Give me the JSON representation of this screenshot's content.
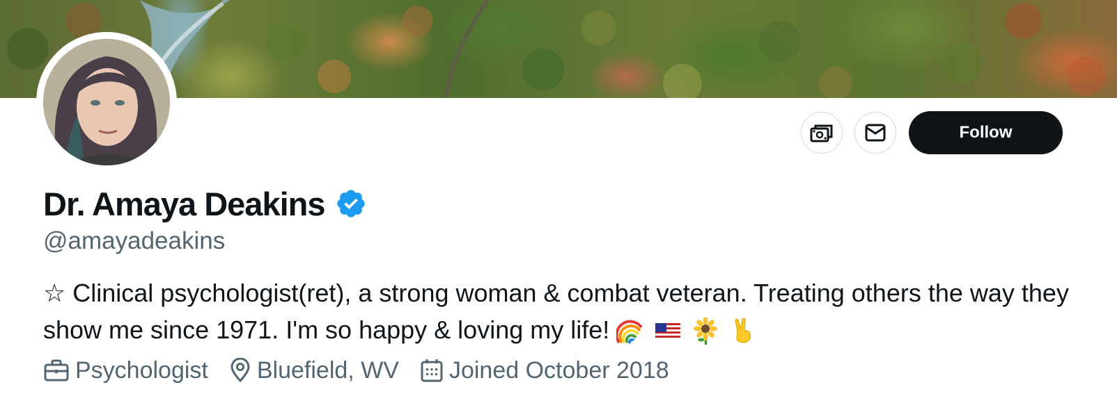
{
  "profile": {
    "display_name": "Dr. Amaya Deakins",
    "handle": "@amayadeakins",
    "verified": true,
    "bio_text": "☆ Clinical psychologist(ret), a strong woman & combat veteran. Treating others the way they show me since 1971. I'm so happy & loving my life!",
    "bio_emojis": [
      "rainbow",
      "us-flag",
      "sunflower",
      "victory-hand"
    ]
  },
  "meta": {
    "profession": "Psychologist",
    "location": "Bluefield, WV",
    "joined": "Joined October 2018"
  },
  "actions": {
    "follow_label": "Follow",
    "tip_icon": "money-icon",
    "message_icon": "envelope-icon"
  },
  "colors": {
    "primary_text": "#0f1419",
    "secondary_text": "#536471",
    "verified_blue": "#1d9bf0",
    "follow_bg": "#0f1419",
    "button_border": "#cfd9de"
  }
}
